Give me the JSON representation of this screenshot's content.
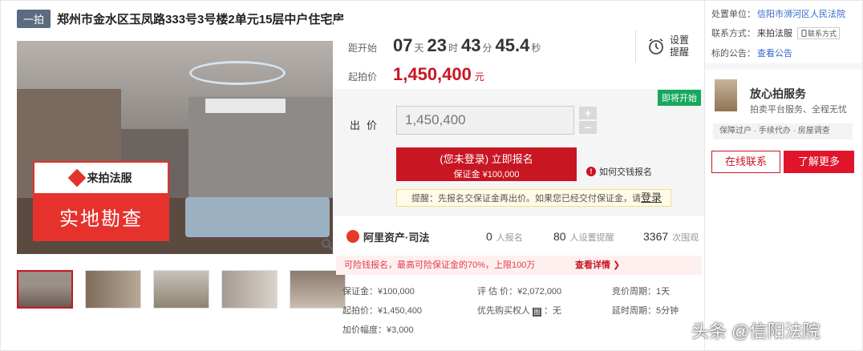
{
  "header": {
    "badge": "一拍",
    "title": "郑州市金水区玉凤路333号3号楼2单元15层中户住宅房"
  },
  "photo": {
    "sign_brand": "来拍法服",
    "sign_text": "实地勘查"
  },
  "countdown": {
    "label": "距开始",
    "days": "07",
    "days_unit": "天",
    "hours": "23",
    "hours_unit": "时",
    "minutes": "43",
    "minutes_unit": "分",
    "seconds": "45.4",
    "seconds_unit": "秒"
  },
  "alarm": {
    "label": "设置提醒"
  },
  "start_price": {
    "label": "起拍价",
    "value": "1,450,400",
    "unit": "元"
  },
  "status_tag": "即将开始",
  "bid": {
    "label": "出价",
    "value": "1,450,400",
    "plus": "+",
    "minus": "−"
  },
  "signup": {
    "line1": "(您未登录) 立即报名",
    "line2": "保证金 ¥100,000"
  },
  "howto": {
    "icon": "!",
    "text": "如何交钱报名"
  },
  "reminder": {
    "text": "提醒：先报名交保证金再出价。如果您已经交付保证金，请",
    "link": "登录"
  },
  "platform": {
    "name": "阿里资产·司法",
    "signups": "0",
    "signups_label": "人报名",
    "reminders": "80",
    "reminders_label": "人设置提醒",
    "views": "3367",
    "views_label": "次围观"
  },
  "pledge": {
    "text": "可险钱报名，最高可险保证金的70%，上限100万",
    "more": "查看详情 ❯"
  },
  "details": {
    "deposit": "保证金：¥100,000",
    "appraisal": "评 估 价：¥2,072,000",
    "cycle": "竞价周期：1天",
    "start": "起拍价：¥1,450,400",
    "priority_label": "优先购买权人",
    "priority_icon": "图",
    "priority_value": "：无",
    "delay": "延时周期：5分钟",
    "increment": "加价幅度：¥3,000"
  },
  "side": {
    "court_label": "处置单位：",
    "court_value": "信阳市浉河区人民法院",
    "contact_label": "联系方式：",
    "contact_value": "来拍法服",
    "contact_tag": "联系方式",
    "notice_label": "标的公告：",
    "notice_link": "查看公告",
    "svc_title": "放心拍服务",
    "svc_sub": "拍卖平台服务、全程无忧",
    "svc_tags": "保障过户 · 手续代办 · 房屋调查",
    "btn_online": "在线联系",
    "btn_more": "了解更多"
  },
  "watermark": "头条 @信阳法院",
  "colors": {
    "accent": "#c81623",
    "green": "#16a85c",
    "link": "#3366cc"
  }
}
